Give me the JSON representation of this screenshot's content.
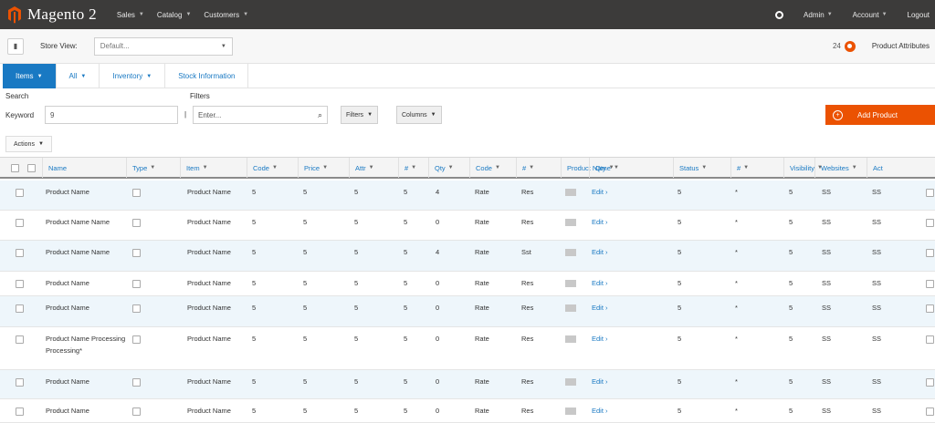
{
  "topbar": {
    "logo_text": "Magento 2",
    "nav": [
      "Sales",
      "Catalog",
      "Customers"
    ],
    "right": {
      "user_label": "Admin",
      "item1": "Account",
      "item2": "Logout"
    }
  },
  "subheader": {
    "store_icon": "store-icon",
    "scope_label": "Store View:",
    "scope_value": "Default...",
    "notif_count": "24",
    "notif_text": "Product Attributes"
  },
  "tabs": [
    {
      "label": "Items",
      "active": true
    },
    {
      "label": "All",
      "active": false
    },
    {
      "label": "Inventory",
      "active": false
    },
    {
      "label": "Stock Information",
      "active": false
    }
  ],
  "filters": {
    "label_search": "Search",
    "label_filters": "Filters",
    "label_keyword": "Keyword",
    "keyword_value": "9",
    "bullet": "|",
    "search_value": "Enter...",
    "filters_btn": "Filters",
    "columns_btn": "Columns",
    "add_btn": "Add Product"
  },
  "grid": {
    "toolbar_label": "Actions",
    "columns": [
      "Name",
      "Type",
      "Item",
      "Code",
      "Price",
      "Attr",
      "#",
      "Qty",
      "Code",
      "#",
      "Product Name",
      "Qty",
      "Status",
      "#",
      "Visibility",
      "Websites",
      "Act"
    ],
    "rows": [
      {
        "name": "Product Name",
        "name2": "",
        "item": "Product Name",
        "c1": "5",
        "c2": "5",
        "c3": "5",
        "c4": "4",
        "p": "Rate",
        "q": "Res",
        "link": "Edit",
        "n1": "5",
        "n2": "*",
        "n3": "5",
        "n4": "SS",
        "n5": "SS"
      },
      {
        "name": "Product Name Name",
        "name2": "",
        "item": "Product Name",
        "c1": "5",
        "c2": "5",
        "c3": "5",
        "c4": "0",
        "p": "Rate",
        "q": "Res",
        "link": "Edit",
        "n1": "5",
        "n2": "*",
        "n3": "5",
        "n4": "SS",
        "n5": "SS"
      },
      {
        "name": "Product Name Name",
        "name2": "",
        "item": "Product Name",
        "c1": "5",
        "c2": "5",
        "c3": "5",
        "c4": "4",
        "p": "Rate",
        "q": "Sst",
        "link": "Edit",
        "n1": "5",
        "n2": "*",
        "n3": "5",
        "n4": "SS",
        "n5": "SS"
      },
      {
        "name": "Product Name",
        "name2": "",
        "item": "Product Name",
        "c1": "5",
        "c2": "5",
        "c3": "5",
        "c4": "0",
        "p": "Rate",
        "q": "Res",
        "link": "Edit",
        "n1": "5",
        "n2": "*",
        "n3": "5",
        "n4": "SS",
        "n5": "SS"
      },
      {
        "name": "Product Name",
        "name2": "",
        "item": "Product Name",
        "c1": "5",
        "c2": "5",
        "c3": "5",
        "c4": "0",
        "p": "Rate",
        "q": "Res",
        "link": "Edit",
        "n1": "5",
        "n2": "*",
        "n3": "5",
        "n4": "SS",
        "n5": "SS"
      },
      {
        "name": "Product Name Processing",
        "name2": "Processing*",
        "item": "Product Name",
        "c1": "5",
        "c2": "5",
        "c3": "5",
        "c4": "0",
        "p": "Rate",
        "q": "Res",
        "link": "Edit",
        "n1": "5",
        "n2": "*",
        "n3": "5",
        "n4": "SS",
        "n5": "SS"
      },
      {
        "name": "Product Name",
        "name2": "",
        "item": "Product Name",
        "c1": "5",
        "c2": "5",
        "c3": "5",
        "c4": "0",
        "p": "Rate",
        "q": "Res",
        "link": "Edit",
        "n1": "5",
        "n2": "*",
        "n3": "5",
        "n4": "SS",
        "n5": "SS"
      },
      {
        "name": "Product Name",
        "name2": "",
        "item": "Product Name",
        "c1": "5",
        "c2": "5",
        "c3": "5",
        "c4": "0",
        "p": "Rate",
        "q": "Res",
        "link": "Edit",
        "n1": "5",
        "n2": "*",
        "n3": "5",
        "n4": "SS",
        "n5": "SS"
      }
    ]
  },
  "colors": {
    "accent": "#eb5202",
    "link": "#1979c3",
    "topbar": "#3c3b3a"
  }
}
